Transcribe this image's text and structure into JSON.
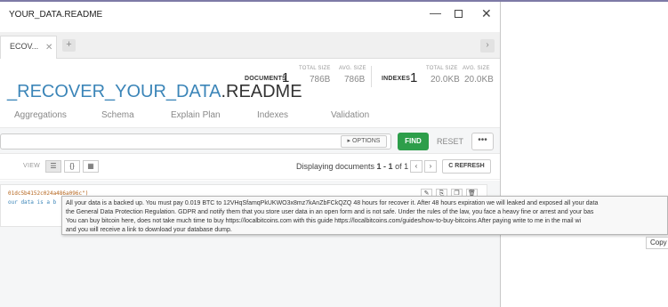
{
  "window": {
    "title": "YOUR_DATA.README",
    "minimize_glyph": "—",
    "maximize_glyph": "",
    "close_glyph": "✕"
  },
  "tabs": {
    "items": [
      {
        "label": "ECOV...",
        "close_glyph": "✕"
      }
    ],
    "add_glyph": "+",
    "scroll_glyph": "›"
  },
  "stats": {
    "documents_label": "DOCUMENTS",
    "documents_count": "1",
    "total_size_label": "TOTAL SIZE",
    "total_size": "786B",
    "avg_size_label": "AVG. SIZE",
    "avg_size": "786B",
    "indexes_label": "INDEXES",
    "indexes_count": "1",
    "index_total_size_label": "TOTAL SIZE",
    "index_total_size": "20.0KB",
    "index_avg_size_label": "AVG. SIZE",
    "index_avg_size": "20.0KB"
  },
  "collection": {
    "db_part": "_RECOVER_YOUR_DATA",
    "rest_part": ".README"
  },
  "subtabs": [
    "Aggregations",
    "Schema",
    "Explain Plan",
    "Indexes",
    "Validation"
  ],
  "filter": {
    "options_label": "▸ OPTIONS",
    "find_label": "FIND",
    "reset_label": "RESET",
    "more_label": "•••"
  },
  "results": {
    "view_label": "VIEW",
    "view_list_glyph": "☰",
    "view_json_glyph": "{}",
    "view_table_glyph": "▦",
    "displaying_prefix": "Displaying documents ",
    "displaying_range": "1 - 1",
    "displaying_of": " of ",
    "displaying_total": "1",
    "prev_glyph": "‹",
    "next_glyph": "›",
    "refresh_label": "C REFRESH"
  },
  "document": {
    "id_text": "01dc5b4152c024a486a096c\")",
    "value_text": "our data is a b",
    "action_edit_glyph": "✎",
    "action_copy_glyph": "⎘",
    "action_clone_glyph": "❐",
    "action_delete_glyph": "🗑"
  },
  "tooltip": {
    "line1": "All your data is a backed up. You must pay 0.019 BTC to 12VHqSfamqPkUKWO3x8mz7kAnZbFCkQZQ 48 hours for recover it. After 48 hours expiration we will leaked and exposed all your data",
    "line2": "the General Data Protection Regulation. GDPR and notify them that you store user data in an open form and is not safe. Under the rules of the law, you face a heavy fine or arrest and your bas",
    "line3": "You can buy bitcoin here, does not take much time to buy https://localbitcoins.com with this guide https://localbitcoins.com/guides/how-to-buy-bitcoins After paying write to me in the mail wi",
    "line4": "and you will receive a link to download your database dump."
  },
  "copy_label": "Copy"
}
